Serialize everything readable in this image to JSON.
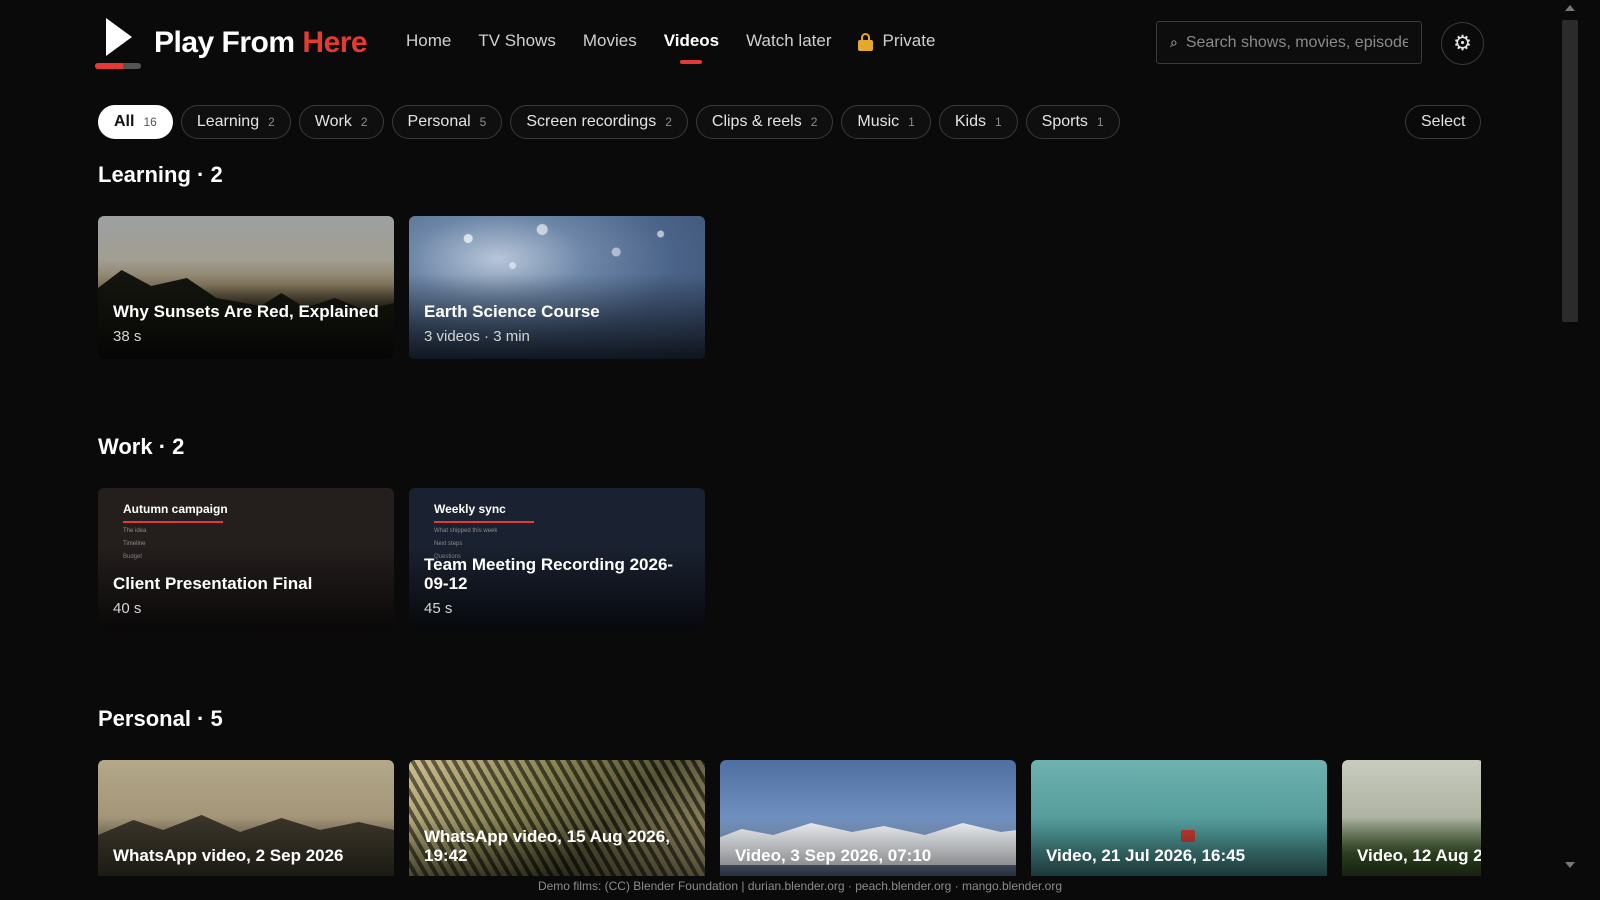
{
  "brand": {
    "name_part1": "Play From",
    "name_part2": "Here",
    "accent_color": "#e53935"
  },
  "nav": {
    "items": [
      {
        "label": "Home"
      },
      {
        "label": "TV Shows"
      },
      {
        "label": "Movies"
      },
      {
        "label": "Videos",
        "active": true
      },
      {
        "label": "Watch later"
      }
    ],
    "private_label": "Private",
    "private_icon": "lock-icon"
  },
  "search": {
    "placeholder": "Search shows, movies, episodes",
    "icon": "search-icon"
  },
  "settings": {
    "icon": "gear-icon",
    "glyph": "⚙"
  },
  "filters": {
    "chips": [
      {
        "label": "All",
        "count": "16",
        "active": true
      },
      {
        "label": "Learning",
        "count": "2"
      },
      {
        "label": "Work",
        "count": "2"
      },
      {
        "label": "Personal",
        "count": "5"
      },
      {
        "label": "Screen recordings",
        "count": "2"
      },
      {
        "label": "Clips & reels",
        "count": "2"
      },
      {
        "label": "Music",
        "count": "1"
      },
      {
        "label": "Kids",
        "count": "1"
      },
      {
        "label": "Sports",
        "count": "1"
      }
    ],
    "select_label": "Select"
  },
  "sections": {
    "learning": {
      "title": "Learning · 2",
      "cards": [
        {
          "title": "Why Sunsets Are Red, Explained",
          "meta": "38 s"
        },
        {
          "title": "Earth Science Course",
          "meta": "3 videos · 3 min"
        }
      ]
    },
    "work": {
      "title": "Work · 2",
      "cards": [
        {
          "title": "Client Presentation Final",
          "meta": "40 s",
          "slide": {
            "heading": "Autumn campaign",
            "lines": [
              "The idea",
              "Timeline",
              "Budget"
            ]
          }
        },
        {
          "title": "Team Meeting Recording 2026-09-12",
          "meta": "45 s",
          "slide": {
            "heading": "Weekly sync",
            "lines": [
              "What shipped this week",
              "Next steps",
              "Questions"
            ]
          }
        }
      ]
    },
    "personal": {
      "title": "Personal · 5",
      "cards": [
        {
          "title": "WhatsApp video, 2 Sep 2026"
        },
        {
          "title": "WhatsApp video, 15 Aug 2026, 19:42"
        },
        {
          "title": "Video, 3 Sep 2026, 07:10"
        },
        {
          "title": "Video, 21 Jul 2026, 16:45"
        },
        {
          "title": "Video, 12 Aug 2"
        }
      ]
    }
  },
  "footer": {
    "text": "Demo films: (CC) Blender Foundation | durian.blender.org · peach.blender.org · mango.blender.org"
  }
}
